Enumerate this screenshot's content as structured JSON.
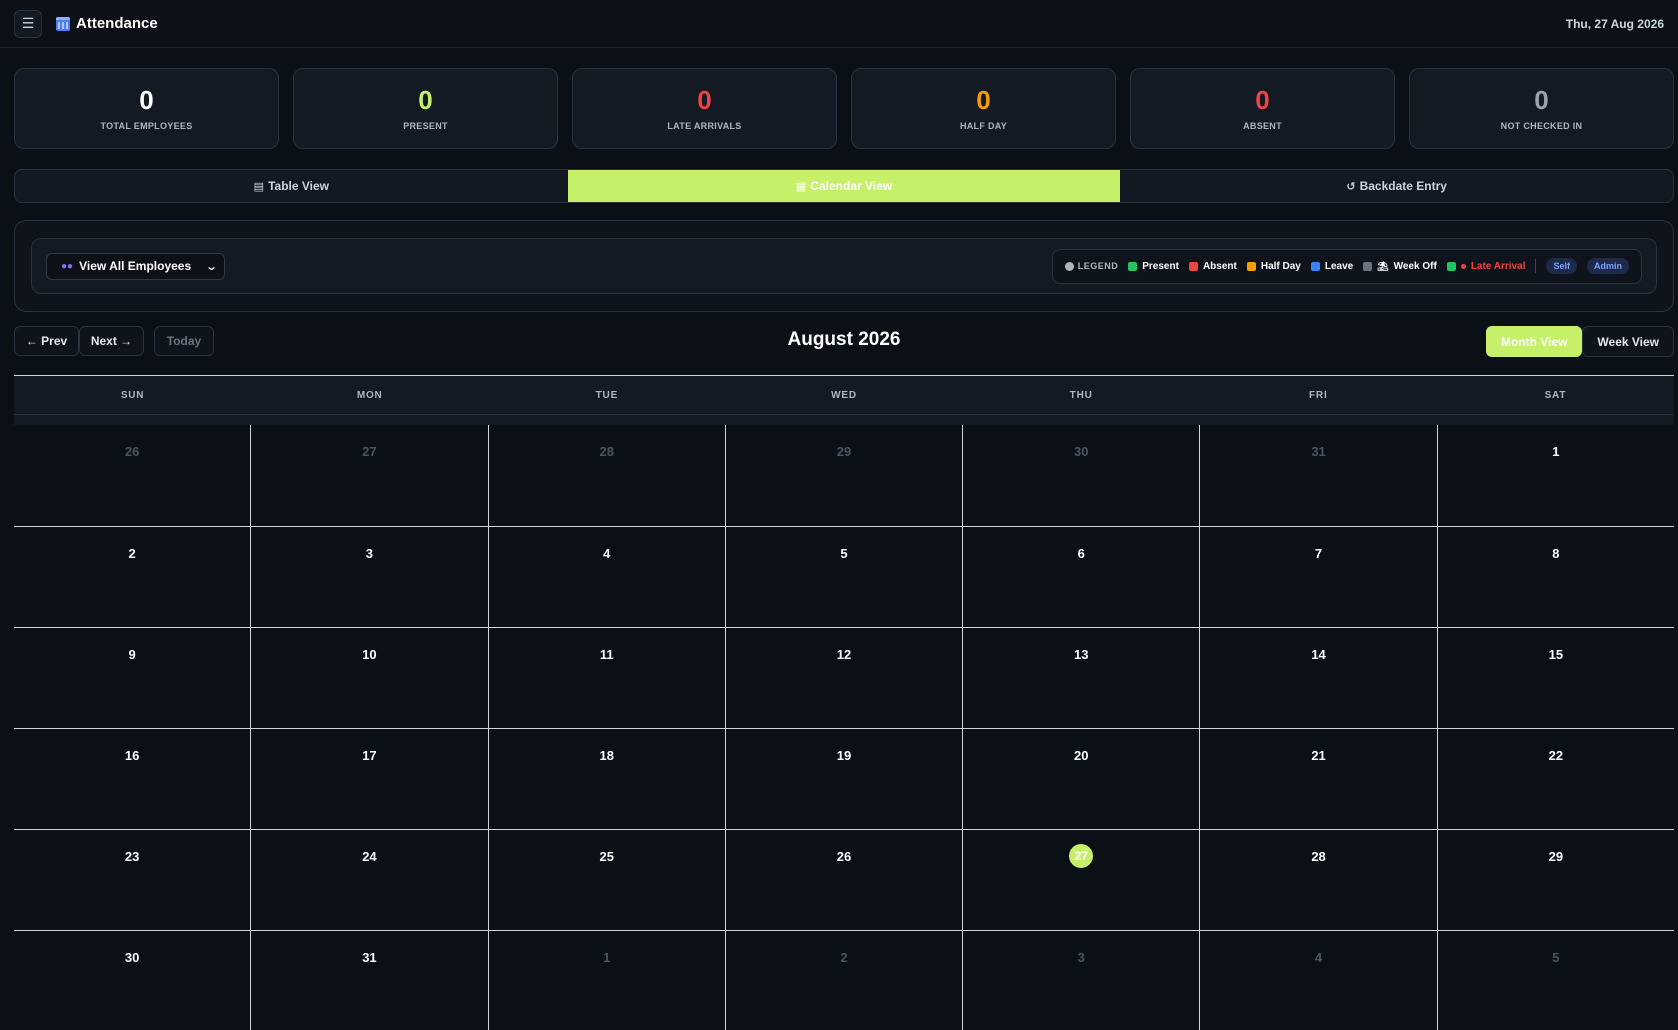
{
  "header": {
    "menu_icon": "hamburger-icon",
    "app_icon": "calendar-icon",
    "title": "Attendance",
    "date": "Thu, 27 Aug 2026"
  },
  "stats": [
    {
      "value": "0",
      "label": "TOTAL EMPLOYEES",
      "color": "#ffffff"
    },
    {
      "value": "0",
      "label": "PRESENT",
      "color": "#c6ef6a"
    },
    {
      "value": "0",
      "label": "LATE ARRIVALS",
      "color": "#ef4444"
    },
    {
      "value": "0",
      "label": "HALF DAY",
      "color": "#f59e0b"
    },
    {
      "value": "0",
      "label": "ABSENT",
      "color": "#ef4444"
    },
    {
      "value": "0",
      "label": "NOT CHECKED IN",
      "color": "#9ca3af"
    }
  ],
  "tabs": [
    {
      "label": "Table View",
      "icon": "table-icon",
      "active": false
    },
    {
      "label": "Calendar View",
      "icon": "calendar-icon",
      "active": true
    },
    {
      "label": "Backdate Entry",
      "icon": "history-icon",
      "active": false
    }
  ],
  "filter": {
    "employee_select": "View All Employees",
    "legend_title": "LEGEND",
    "legend": [
      {
        "label": "Present",
        "color": "#22c55e"
      },
      {
        "label": "Absent",
        "color": "#ef4444"
      },
      {
        "label": "Half Day",
        "color": "#f59e0b"
      },
      {
        "label": "Leave",
        "color": "#3b82f6"
      },
      {
        "label": "Week Off",
        "color": "#6b7280"
      },
      {
        "label": "Late Arrival",
        "color": "#22c55e"
      }
    ],
    "badges": [
      "Self",
      "Admin"
    ]
  },
  "nav": {
    "prev": "← Prev",
    "next": "Next →",
    "today": "Today",
    "month_title": "August 2026",
    "month_view": "Month View",
    "week_view": "Week View"
  },
  "calendar": {
    "days_of_week": [
      "SUN",
      "MON",
      "TUE",
      "WED",
      "THU",
      "FRI",
      "SAT"
    ],
    "today": "27",
    "weeks": [
      [
        {
          "d": "26",
          "m": true
        },
        {
          "d": "27",
          "m": true
        },
        {
          "d": "28",
          "m": true
        },
        {
          "d": "29",
          "m": true
        },
        {
          "d": "30",
          "m": true
        },
        {
          "d": "31",
          "m": true
        },
        {
          "d": "1",
          "m": false
        }
      ],
      [
        {
          "d": "2",
          "m": false
        },
        {
          "d": "3",
          "m": false
        },
        {
          "d": "4",
          "m": false
        },
        {
          "d": "5",
          "m": false
        },
        {
          "d": "6",
          "m": false
        },
        {
          "d": "7",
          "m": false
        },
        {
          "d": "8",
          "m": false
        }
      ],
      [
        {
          "d": "9",
          "m": false
        },
        {
          "d": "10",
          "m": false
        },
        {
          "d": "11",
          "m": false
        },
        {
          "d": "12",
          "m": false
        },
        {
          "d": "13",
          "m": false
        },
        {
          "d": "14",
          "m": false
        },
        {
          "d": "15",
          "m": false
        }
      ],
      [
        {
          "d": "16",
          "m": false
        },
        {
          "d": "17",
          "m": false
        },
        {
          "d": "18",
          "m": false
        },
        {
          "d": "19",
          "m": false
        },
        {
          "d": "20",
          "m": false
        },
        {
          "d": "21",
          "m": false
        },
        {
          "d": "22",
          "m": false
        }
      ],
      [
        {
          "d": "23",
          "m": false
        },
        {
          "d": "24",
          "m": false
        },
        {
          "d": "25",
          "m": false
        },
        {
          "d": "26",
          "m": false
        },
        {
          "d": "27",
          "m": false,
          "today": true
        },
        {
          "d": "28",
          "m": false
        },
        {
          "d": "29",
          "m": false
        }
      ],
      [
        {
          "d": "30",
          "m": false
        },
        {
          "d": "31",
          "m": false
        },
        {
          "d": "1",
          "m": true
        },
        {
          "d": "2",
          "m": true
        },
        {
          "d": "3",
          "m": true
        },
        {
          "d": "4",
          "m": true
        },
        {
          "d": "5",
          "m": true
        }
      ]
    ]
  }
}
